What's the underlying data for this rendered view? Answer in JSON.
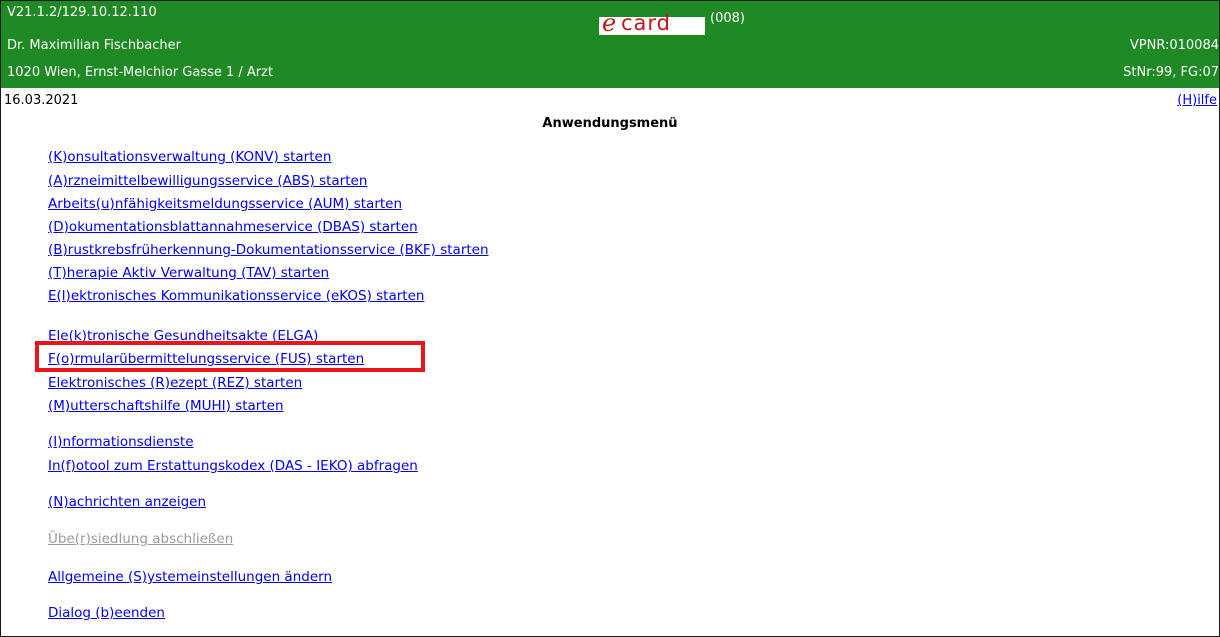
{
  "header": {
    "version": "V21.1.2/129.10.12.110",
    "doctor_name": "Dr. Maximilian Fischbacher",
    "address": "1020 Wien, Ernst-Melchior Gasse 1 / Arzt",
    "vpnr": "VPNR:010084",
    "stnr": "StNr:99, FG:07",
    "logo_text": "ecard",
    "code": "(008)",
    "brand_color": "#1f8a24",
    "logo_color": "#c0161c"
  },
  "date": "16.03.2021",
  "help_label": "(H)ilfe",
  "title": "Anwendungsmenü",
  "menu": [
    "(K)onsultationsverwaltung (KONV) starten",
    "(A)rzneimittelbewilligungsservice (ABS) starten",
    "Arbeits(u)nfähigkeitsmeldungsservice (AUM) starten",
    "(D)okumentationsblattannahmeservice (DBAS) starten",
    "(B)rustkrebsfrüherkennung-Dokumentationsservice (BKF) starten",
    "(T)herapie Aktiv Verwaltung (TAV) starten",
    "E(l)ektronisches Kommunikationsservice (eKOS) starten",
    "Ele(k)tronische Gesundheitsakte (ELGA)",
    "F(o)rmularübermittelungsservice (FUS) starten",
    "Elektronisches (R)ezept (REZ) starten",
    "(M)utterschaftshilfe (MUHI) starten",
    "(I)nformationsdienste",
    "In(f)otool zum Erstattungskodex (DAS - IEKO) abfragen",
    "(N)achrichten anzeigen",
    "Übe(r)siedlung abschließen",
    "Allgemeine (S)ystemeinstellungen ändern",
    "Dialog (b)eenden"
  ],
  "highlighted_item": "F(o)rmularübermittelungsservice (FUS) starten",
  "highlight_color": "#e8151b"
}
